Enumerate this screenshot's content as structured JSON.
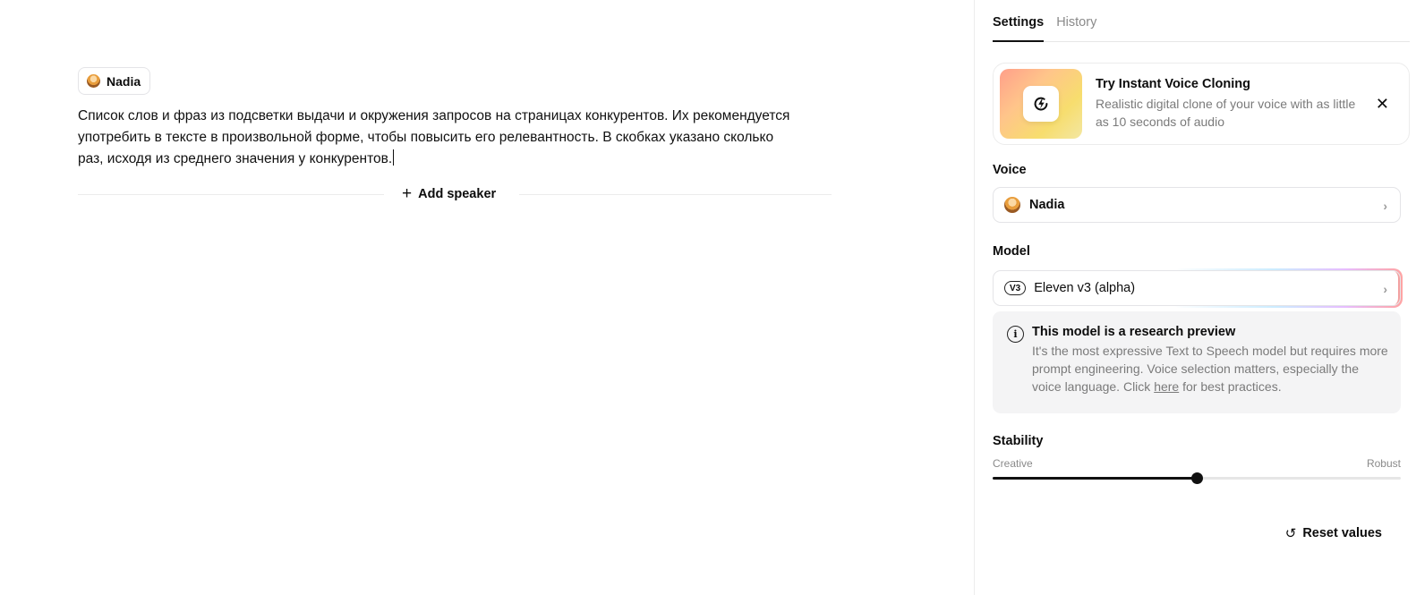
{
  "editor": {
    "speaker": {
      "name": "Nadia",
      "icon": "avatar-icon"
    },
    "text": "Список слов и фраз из подсветки выдачи и окружения запросов на страницах конкурентов. Их рекомендуется употребить в тексте в произвольной форме, чтобы повысить его релевантность. В скобках указано сколько раз, исходя из среднего значения у конкурентов.",
    "add_speaker_label": "Add speaker",
    "add_speaker_icon": "plus-icon"
  },
  "panel": {
    "tabs": [
      {
        "label": "Settings",
        "active": true
      },
      {
        "label": "History",
        "active": false
      }
    ],
    "promo": {
      "title": "Try Instant Voice Cloning",
      "description": "Realistic digital clone of your voice with as little as 10 seconds of audio",
      "icon": "lightning-clone-icon",
      "close_icon": "close-icon"
    },
    "voice": {
      "label": "Voice",
      "value": "Nadia",
      "icon": "avatar-icon"
    },
    "model": {
      "label": "Model",
      "badge": "V3",
      "value": "Eleven v3 (alpha)"
    },
    "info": {
      "icon": "info-icon",
      "title": "This model is a research preview",
      "body_before": "It's the most expressive Text to Speech model but requires more prompt engineering. Voice selection matters, especially the voice language. Click ",
      "link": "here",
      "body_after": " for best practices."
    },
    "stability": {
      "label": "Stability",
      "min_label": "Creative",
      "max_label": "Robust",
      "value": 0.5
    },
    "reset_label": "Reset values",
    "reset_icon": "reset-icon"
  },
  "colors": {
    "accent": "#111111",
    "muted_text": "#7a7a7a",
    "info_bg": "#f4f4f5"
  }
}
